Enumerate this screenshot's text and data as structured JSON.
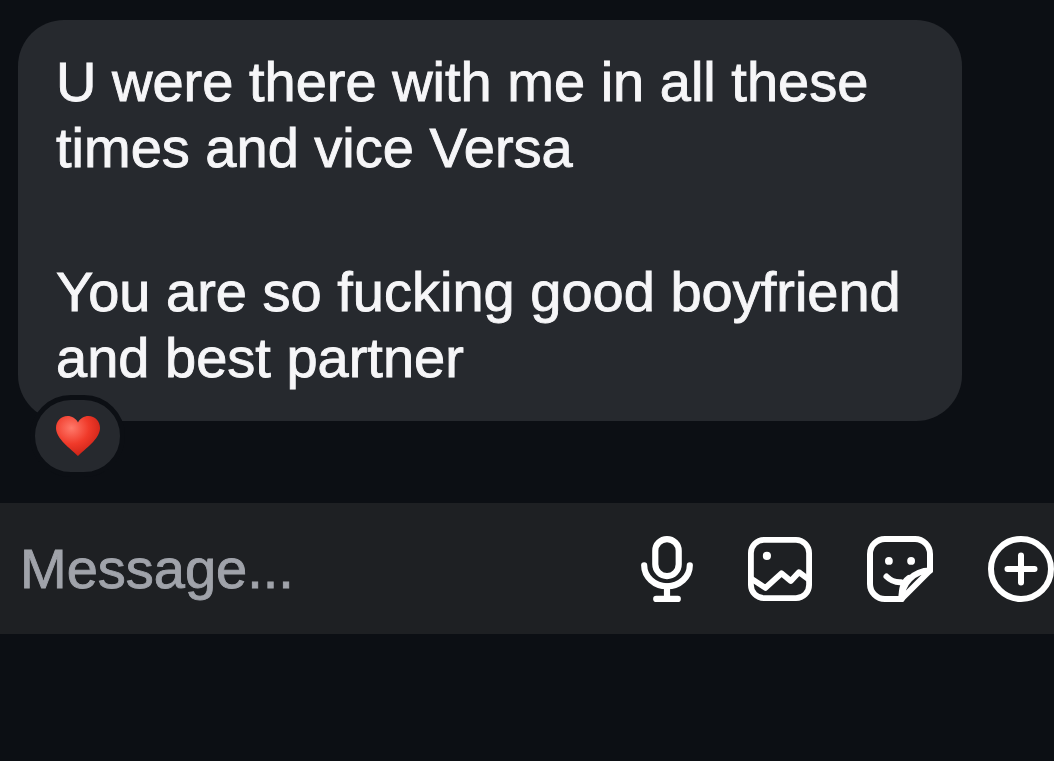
{
  "message": {
    "paragraphs": [
      "U were there with me in all these times and vice Versa",
      "You are so fucking good boyfriend and best partner"
    ],
    "reaction": {
      "kind": "heart"
    }
  },
  "composer": {
    "placeholder": "Message...",
    "actions": [
      {
        "kind": "microphone"
      },
      {
        "kind": "image"
      },
      {
        "kind": "sticker"
      },
      {
        "kind": "add"
      }
    ]
  }
}
